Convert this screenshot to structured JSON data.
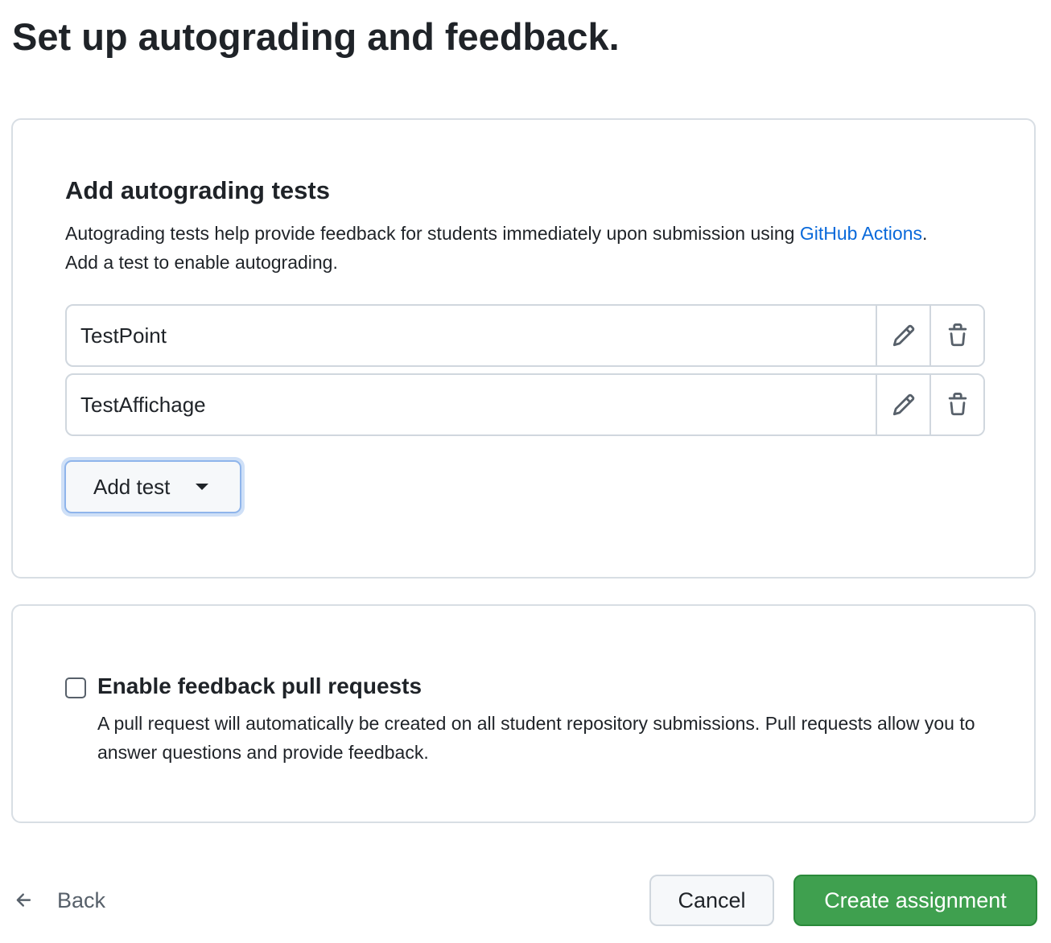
{
  "page": {
    "title": "Set up autograding and feedback."
  },
  "autograding": {
    "heading": "Add autograding tests",
    "description_before_link": "Autograding tests help provide feedback for students immediately upon submission using ",
    "link_text": "GitHub Actions",
    "description_after_link": ".",
    "description_line2": "Add a test to enable autograding.",
    "tests": [
      {
        "name": "TestPoint"
      },
      {
        "name": "TestAffichage"
      }
    ],
    "edit_icon": "pencil-icon",
    "delete_icon": "trash-icon",
    "add_test_label": "Add test"
  },
  "feedback": {
    "checkbox_checked": false,
    "heading": "Enable feedback pull requests",
    "description": "A pull request will automatically be created on all student repository submissions. Pull requests allow you to answer questions and provide feedback."
  },
  "footer": {
    "back_label": "Back",
    "cancel_label": "Cancel",
    "create_label": "Create assignment"
  },
  "colors": {
    "link": "#0969da",
    "primary_button": "#3fa04f",
    "focus_ring": "#cfe0f7"
  }
}
